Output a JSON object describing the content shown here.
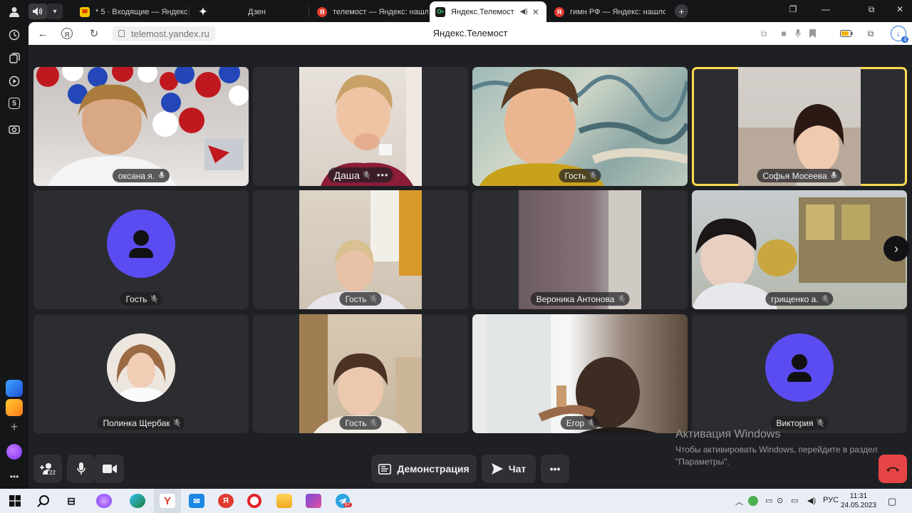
{
  "tabs": [
    {
      "title": "* 5 · Входящие — Яндекс Почта",
      "favicon": "mail-icon",
      "active": false
    },
    {
      "title": "Дзен",
      "favicon": "zen-icon",
      "active": false
    },
    {
      "title": "телемост — Яндекс: нашлось",
      "favicon": "yandex-icon",
      "active": false
    },
    {
      "title": "Яндекс.Телемост",
      "favicon": "telemost-icon",
      "active": true
    },
    {
      "title": "гимн РФ — Яндекс: нашлось",
      "favicon": "yandex-icon",
      "active": false
    }
  ],
  "sidebar": {
    "badge_tab_count": "5"
  },
  "address_bar": {
    "url": "telemost.yandex.ru",
    "page_title": "Яндекс.Телемост",
    "downloads_badge": "4"
  },
  "participants": [
    {
      "name": "оксана я.",
      "mic": "on",
      "video": true
    },
    {
      "name": "Даша",
      "mic": "off",
      "video": true,
      "more": "•••"
    },
    {
      "name": "Гость",
      "mic": "off",
      "video": true
    },
    {
      "name": "Софья Мосеева",
      "mic": "on",
      "video": true,
      "speaking": true
    },
    {
      "name": "Гость",
      "mic": "off",
      "video": false
    },
    {
      "name": "Гость",
      "mic": "off",
      "video": true
    },
    {
      "name": "Вероника Антонова",
      "mic": "off",
      "video": true
    },
    {
      "name": "грищенко а.",
      "mic": "off",
      "video": true
    },
    {
      "name": "Полинка Щербак",
      "mic": "off",
      "video": false,
      "photo": true
    },
    {
      "name": "Гость",
      "mic": "off",
      "video": true
    },
    {
      "name": "Егор",
      "mic": "off",
      "video": true
    },
    {
      "name": "Виктория",
      "mic": "off",
      "video": false
    }
  ],
  "toolbar": {
    "participants_count": "22",
    "screen_share_label": "Демонстрация",
    "chat_label": "Чат",
    "more_label": "•••"
  },
  "activation": {
    "title": "Активация Windows",
    "text_line1": "Чтобы активировать Windows, перейдите в раздел",
    "text_line2": "\"Параметры\"."
  },
  "taskbar": {
    "telegram_badge": "67",
    "language": "РУС",
    "time": "11:31",
    "date": "24.05.2023"
  },
  "colors": {
    "accent_purple": "#5b4cf2",
    "speaking_border": "#ffdb4d",
    "end_call": "#e64545",
    "background": "#1f2023"
  }
}
